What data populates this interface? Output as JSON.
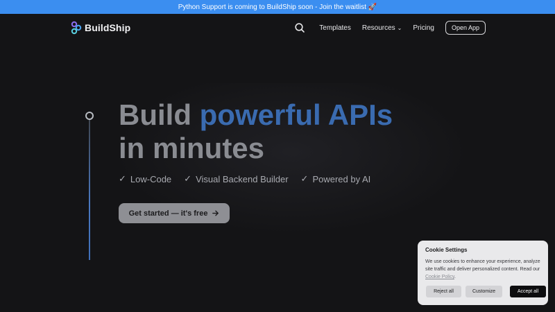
{
  "banner": {
    "text": "Python Support is coming to BuildShip soon - Join the waitlist 🚀"
  },
  "nav": {
    "logo_text": "BuildShip",
    "links": [
      "Templates",
      "Resources",
      "Pricing"
    ],
    "cta": "Open App"
  },
  "hero": {
    "title_line1_plain": "Build",
    "title_line1_accent": "powerful APIs",
    "title_line2": "in minutes",
    "features": [
      "Low-Code",
      "Visual Backend Builder",
      "Powered by AI"
    ],
    "cta": "Get started — it's free",
    "accent_color": "#3a6bb0"
  },
  "cookie": {
    "title": "Cookie Settings",
    "text": "We use cookies to enhance your experience, analyze site traffic and deliver personalized content. Read our",
    "link": "Cookie Policy",
    "text_end": ".",
    "buttons": {
      "reject": "Reject all",
      "customize": "Customize",
      "accept": "Accept all"
    }
  }
}
